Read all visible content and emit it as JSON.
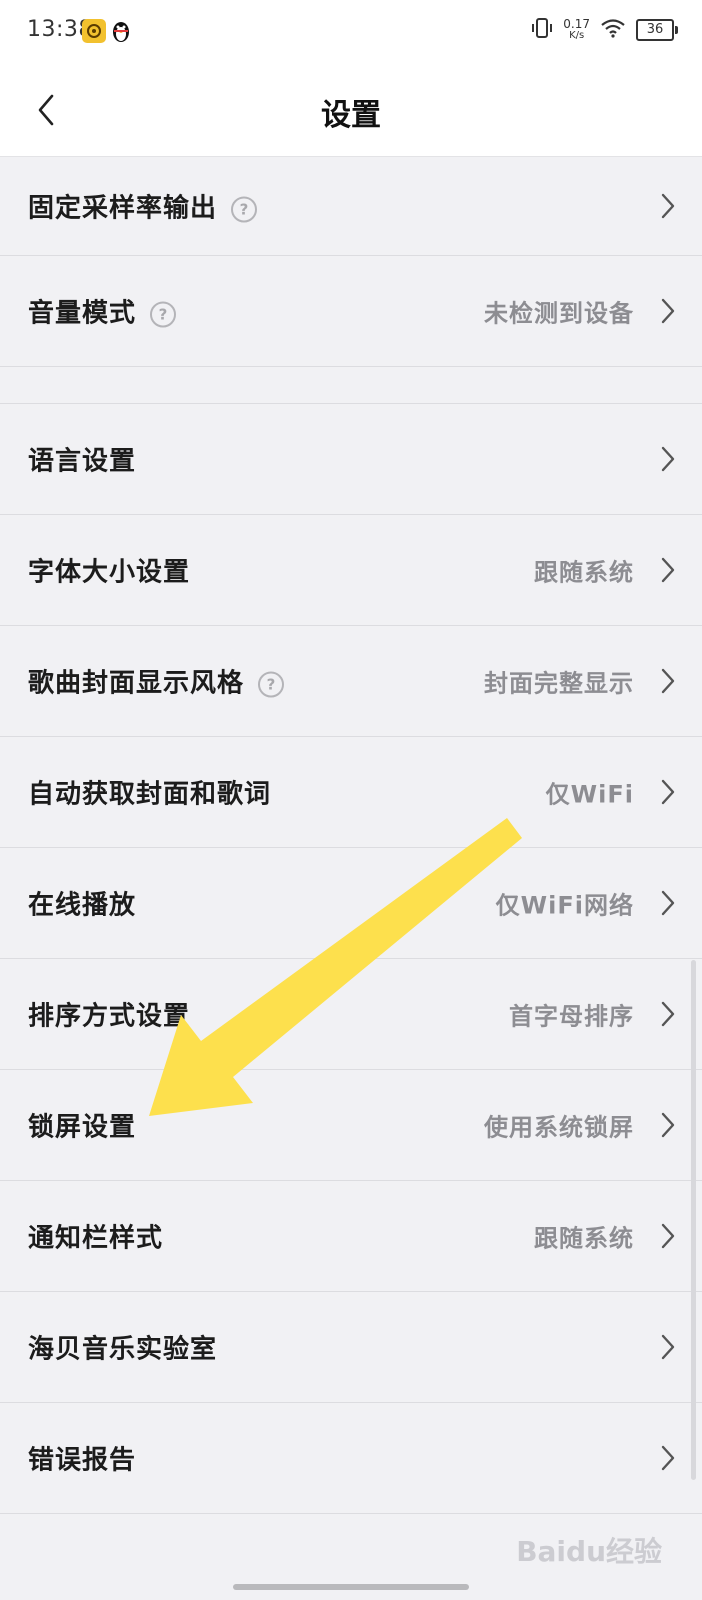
{
  "status_bar": {
    "time": "13:38",
    "net_speed_value": "0.17",
    "net_speed_unit": "K/s",
    "battery": "36"
  },
  "header": {
    "title": "设置"
  },
  "settings": {
    "items": [
      {
        "label": "固定采样率输出",
        "value": ""
      },
      {
        "label": "音量模式",
        "value": "未检测到设备"
      },
      {
        "label": "语言设置",
        "value": ""
      },
      {
        "label": "字体大小设置",
        "value": "跟随系统"
      },
      {
        "label": "歌曲封面显示风格",
        "value": "封面完整显示"
      },
      {
        "label": "自动获取封面和歌词",
        "value": "仅WiFi"
      },
      {
        "label": "在线播放",
        "value": "仅WiFi网络"
      },
      {
        "label": "排序方式设置",
        "value": "首字母排序"
      },
      {
        "label": "锁屏设置",
        "value": "使用系统锁屏"
      },
      {
        "label": "通知栏样式",
        "value": "跟随系统"
      },
      {
        "label": "海贝音乐实验室",
        "value": ""
      },
      {
        "label": "错误报告",
        "value": ""
      }
    ]
  },
  "help_glyph": "?",
  "watermark": "Baidu经验",
  "colors": {
    "arrow": "#fde04d",
    "background": "#f1f1f4",
    "value_text": "#8d8d92"
  }
}
